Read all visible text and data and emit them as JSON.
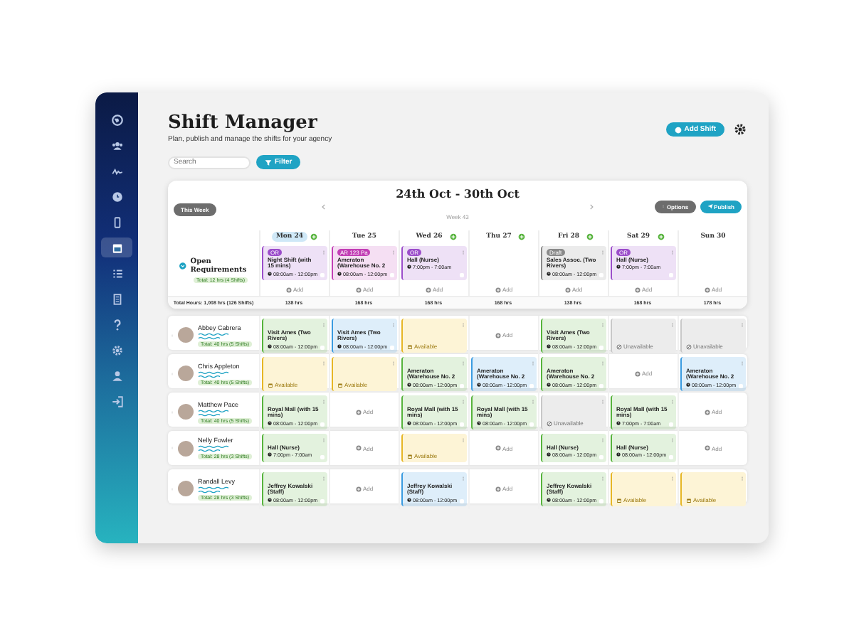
{
  "sidebar": {
    "items": [
      {
        "selected": false
      },
      {
        "selected": false
      },
      {
        "selected": false
      },
      {
        "selected": false
      },
      {
        "selected": false
      },
      {
        "selected": true
      },
      {
        "selected": false
      },
      {
        "selected": false
      },
      {
        "selected": false
      },
      {
        "selected": false
      },
      {
        "selected": false
      },
      {
        "selected": false
      }
    ]
  },
  "header": {
    "title": "Shift Manager",
    "subtitle": "Plan, publish and manage the shifts for your agency",
    "add_button": "Add Shift",
    "search": {
      "placeholder": "Search"
    },
    "filter_button": "Filter"
  },
  "week": {
    "this_week_button": "This Week",
    "title": "24th Oct - 30th Oct",
    "subtitle": "Week 43",
    "options_button": "Options",
    "publish_button": "Publish",
    "days": [
      {
        "label": "Mon 24",
        "selected": true,
        "addable": true
      },
      {
        "label": "Tue 25",
        "selected": false,
        "addable": false
      },
      {
        "label": "Wed 26",
        "selected": false,
        "addable": true
      },
      {
        "label": "Thu 27",
        "selected": false,
        "addable": true
      },
      {
        "label": "Fri 28",
        "selected": false,
        "addable": true
      },
      {
        "label": "Sat 29",
        "selected": false,
        "addable": true
      },
      {
        "label": "Sun 30",
        "selected": false,
        "addable": false
      }
    ],
    "open_requirements": {
      "label": "Open Requirements",
      "badge": "Total: 12 hrs (4 Shifts)",
      "cells": [
        {
          "kind": "shift",
          "color": "#9b4dca",
          "tag": "OR",
          "title": "Night Shift (with 15 mins)",
          "time": "08:00am - 12:00pm",
          "add": "Add"
        },
        {
          "kind": "shift",
          "color": "#c23fb5",
          "tag": "AR 123 Pa",
          "title": "Ameraton (Warehouse No. 2",
          "time": "08:00am - 12:00pm",
          "add": "Add"
        },
        {
          "kind": "shift",
          "color": "#9b4dca",
          "tag": "OR",
          "title": "Hall (Nurse)",
          "time": "7:00pm - 7:00am",
          "add": "Add"
        },
        {
          "kind": "empty",
          "add": "Add"
        },
        {
          "kind": "shift",
          "color": "#8a8a8a",
          "tag": "Draft",
          "title": "Sales Assoc. (Two Rivers)",
          "time": "08:00am - 12:00pm",
          "add": "Add"
        },
        {
          "kind": "shift",
          "color": "#9b4dca",
          "tag": "OR",
          "title": "Hall (Nurse)",
          "time": "7:00pm - 7:00am",
          "add": "Add"
        },
        {
          "kind": "empty",
          "add": "Add"
        }
      ]
    },
    "totals": {
      "label": "Total Hours: 1,008 hrs (126 Shifts)",
      "values": [
        "138 hrs",
        "168 hrs",
        "168 hrs",
        "168 hrs",
        "138 hrs",
        "168 hrs",
        "178 hrs"
      ]
    }
  },
  "staff": [
    {
      "name": "Abbey Cabrera",
      "badge": "Total: 40 hrs (5 Shifts)",
      "cells": [
        {
          "kind": "shift",
          "color": "#56b33c",
          "title": "Visit Ames (Two Rivers)",
          "time": "08:00am - 12:00pm"
        },
        {
          "kind": "shift",
          "color": "#3a9be0",
          "title": "Visit Ames (Two Rivers)",
          "time": "08:00am - 12:00pm"
        },
        {
          "kind": "available",
          "text": "Available"
        },
        {
          "kind": "empty",
          "text": "Add"
        },
        {
          "kind": "shift",
          "color": "#56b33c",
          "title": "Visit Ames (Two Rivers)",
          "time": "08:00am - 12:00pm"
        },
        {
          "kind": "unavailable",
          "text": "Unavailable"
        },
        {
          "kind": "unavailable",
          "text": "Unavailable"
        }
      ]
    },
    {
      "name": "Chris Appleton",
      "badge": "Total: 40 hrs (5 Shifts)",
      "cells": [
        {
          "kind": "available",
          "text": "Available"
        },
        {
          "kind": "available",
          "text": "Available"
        },
        {
          "kind": "shift",
          "color": "#56b33c",
          "title": "Ameraton (Warehouse No. 2",
          "time": "08:00am - 12:00pm"
        },
        {
          "kind": "shift",
          "color": "#3a9be0",
          "title": "Ameraton (Warehouse No. 2",
          "time": "08:00am - 12:00pm"
        },
        {
          "kind": "shift",
          "color": "#56b33c",
          "title": "Ameraton (Warehouse No. 2",
          "time": "08:00am - 12:00pm"
        },
        {
          "kind": "empty",
          "text": "Add"
        },
        {
          "kind": "shift",
          "color": "#3a9be0",
          "title": "Ameraton (Warehouse No. 2",
          "time": "08:00am - 12:00pm"
        }
      ]
    },
    {
      "name": "Matthew Pace",
      "badge": "Total: 40 hrs (5 Shifts)",
      "cells": [
        {
          "kind": "shift",
          "color": "#56b33c",
          "title": "Royal Mall (with 15 mins)",
          "time": "08:00am - 12:00pm"
        },
        {
          "kind": "empty",
          "text": "Add"
        },
        {
          "kind": "shift",
          "color": "#56b33c",
          "title": "Royal Mall (with 15 mins)",
          "time": "08:00am - 12:00pm"
        },
        {
          "kind": "shift",
          "color": "#56b33c",
          "title": "Royal Mall (with 15 mins)",
          "time": "08:00am - 12:00pm"
        },
        {
          "kind": "unavailable",
          "text": "Unavailable"
        },
        {
          "kind": "shift",
          "color": "#56b33c",
          "title": "Royal Mall (with 15 mins)",
          "time": "7:00pm - 7:00am"
        },
        {
          "kind": "empty",
          "text": "Add"
        }
      ]
    },
    {
      "name": "Nelly Fowler",
      "badge": "Total: 28 hrs (3 Shifts)",
      "cells": [
        {
          "kind": "shift",
          "color": "#56b33c",
          "title": "Hall (Nurse)",
          "time": "7:00pm - 7:00am"
        },
        {
          "kind": "empty",
          "text": "Add"
        },
        {
          "kind": "available",
          "text": "Available"
        },
        {
          "kind": "empty",
          "text": "Add"
        },
        {
          "kind": "shift",
          "color": "#56b33c",
          "title": "Hall (Nurse)",
          "time": "08:00am - 12:00pm"
        },
        {
          "kind": "shift",
          "color": "#56b33c",
          "title": "Hall (Nurse)",
          "time": "08:00am - 12:00pm"
        },
        {
          "kind": "empty",
          "text": "Add"
        }
      ]
    },
    {
      "name": "Randall Levy",
      "badge": "Total: 28 hrs (3 Shifts)",
      "cells": [
        {
          "kind": "shift",
          "color": "#56b33c",
          "title": "Jeffrey Kowalski (Staff)",
          "time": "08:00am - 12:00pm"
        },
        {
          "kind": "empty",
          "text": "Add"
        },
        {
          "kind": "shift",
          "color": "#3a9be0",
          "title": "Jeffrey Kowalski (Staff)",
          "time": "08:00am - 12:00pm"
        },
        {
          "kind": "empty",
          "text": "Add"
        },
        {
          "kind": "shift",
          "color": "#56b33c",
          "title": "Jeffrey Kowalski (Staff)",
          "time": "08:00am - 12:00pm"
        },
        {
          "kind": "available",
          "text": "Available"
        },
        {
          "kind": "available",
          "text": "Available"
        }
      ]
    }
  ]
}
